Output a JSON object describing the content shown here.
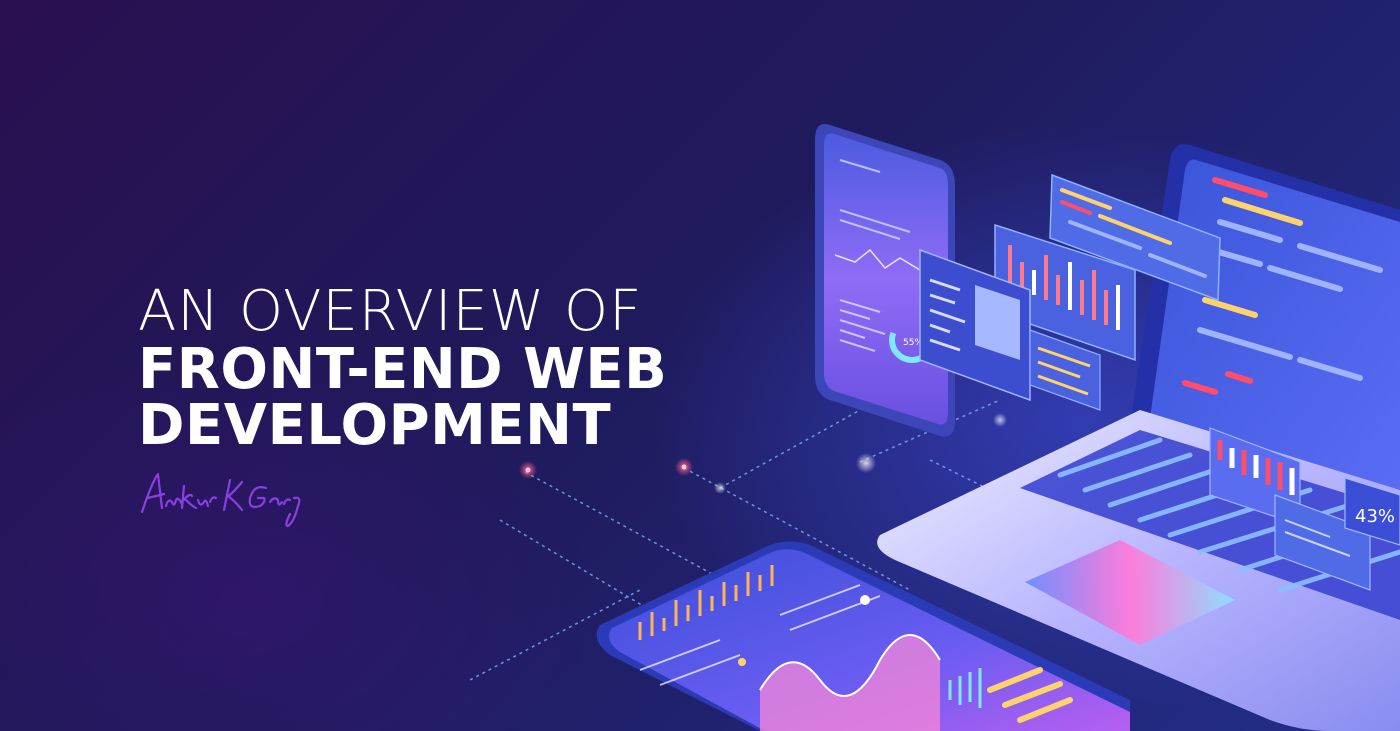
{
  "hero": {
    "title_line_1": "AN OVERVIEW OF",
    "title_line_2": "FRONT-END WEB",
    "title_line_3": "DEVELOPMENT"
  },
  "signature": {
    "text": "Ankur K Garg"
  },
  "illustration": {
    "phone_gauge_label": "55%",
    "laptop_gauge_label": "43%"
  },
  "colors": {
    "background_dark": "#1e1650",
    "background_blue": "#232e8a",
    "accent_red": "#ff4d6a",
    "accent_cyan": "#6fe3ff",
    "accent_yellow": "#ffd36b",
    "signature_purple": "#8a3fe0"
  }
}
